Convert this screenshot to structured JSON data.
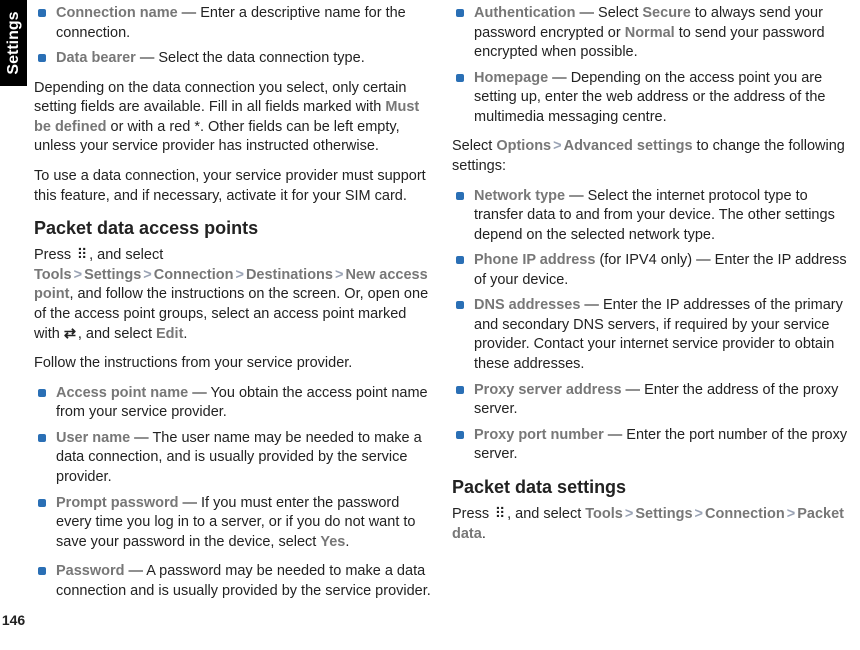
{
  "sidebar": {
    "tab": "Settings",
    "page_number": "146"
  },
  "menu_icon": "⠿",
  "edit_icon": "⇄",
  "col1": {
    "items_top": [
      {
        "term": "Connection name",
        "desc": " — Enter a descriptive name for the connection."
      },
      {
        "term": "Data bearer",
        "desc": " — Select the data connection type."
      }
    ],
    "para1a": "Depending on the data connection you select, only certain setting fields are available. Fill in all fields marked with ",
    "para1b": "Must be defined",
    "para1c": " or with a red *. Other fields can be left empty, unless your service provider has instructed otherwise.",
    "para2": "To use a data connection, your service provider must support this feature, and if necessary, activate it for your SIM card.",
    "h_packet_ap": "Packet data access points",
    "nav1": {
      "tools": "Tools",
      "settings": "Settings",
      "connection": "Connection",
      "destinations": "Destinations",
      "nap": "New access point",
      "edit": "Edit"
    },
    "press": "Press ",
    "and_select": ", and select ",
    "nap_tail1": ", and follow the instructions on the screen. Or, open one of the access point groups, select an access point marked with ",
    "nap_tail2": ", and select ",
    "period": ".",
    "para3": "Follow the instructions from your service provider.",
    "items_ap": [
      {
        "term": "Access point name",
        "desc": " — You obtain the access point name from your service provider."
      },
      {
        "term": "User name",
        "desc": " — The user name may be needed to make a data connection, and is usually provided by the service provider."
      },
      {
        "term": "Prompt password",
        "desc_a": " — If you must enter the password every time you log in to a server, or if you do not want to save your password in the device, select ",
        "yes": "Yes",
        "desc_b": "."
      }
    ]
  },
  "col2": {
    "items_a": [
      {
        "term": "Password",
        "desc": " — A password may be needed to make a data connection and is usually provided by the service provider."
      },
      {
        "term": "Authentication",
        "desc_a": " — Select ",
        "secure": "Secure",
        "desc_b": " to always send your password encrypted or ",
        "normal": "Normal",
        "desc_c": " to send your password encrypted when possible."
      },
      {
        "term": "Homepage",
        "desc": " — Depending on the access point you are setting up, enter the web address or the address of the multimedia messaging centre."
      }
    ],
    "adv_a": "Select ",
    "adv_options": "Options",
    "adv_advanced": "Advanced settings",
    "adv_b": " to change the following settings:",
    "items_b": [
      {
        "term": "Network type",
        "desc": " — Select the internet protocol type to transfer data to and from your device. The other settings depend on the selected network type."
      },
      {
        "term": "Phone IP address",
        "extra": " (for IPV4 only)",
        "desc": " — Enter the IP address of your device."
      },
      {
        "term": "DNS addresses",
        "desc": " — Enter the IP addresses of the primary and secondary DNS servers, if required by your service provider. Contact your internet service provider to obtain these addresses."
      },
      {
        "term": "Proxy server address",
        "desc": " — Enter the address of the proxy server."
      },
      {
        "term": "Proxy port number",
        "desc": " — Enter the port number of the proxy server."
      }
    ],
    "h_packet_settings": "Packet data settings",
    "nav2": {
      "tools": "Tools",
      "settings": "Settings",
      "connection": "Connection",
      "pd": "Packet data"
    }
  }
}
